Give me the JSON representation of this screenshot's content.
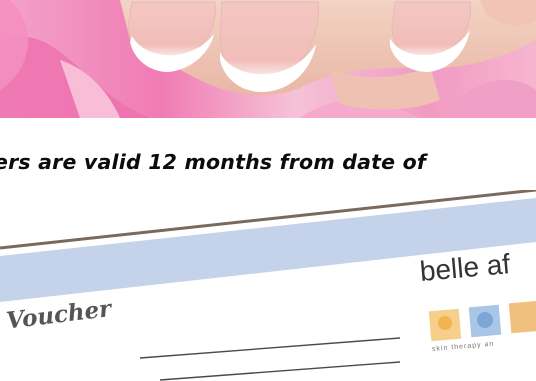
{
  "banner": {
    "text": "ers are valid 12 months from date of"
  },
  "voucher": {
    "title": "t Voucher",
    "brand": "belle af",
    "tagline": "skin  therapy  an"
  },
  "colors": {
    "voucher_band": "#c4d3ea",
    "voucher_border": "#7a6a5e",
    "photo_pink": "#f07bb3"
  }
}
